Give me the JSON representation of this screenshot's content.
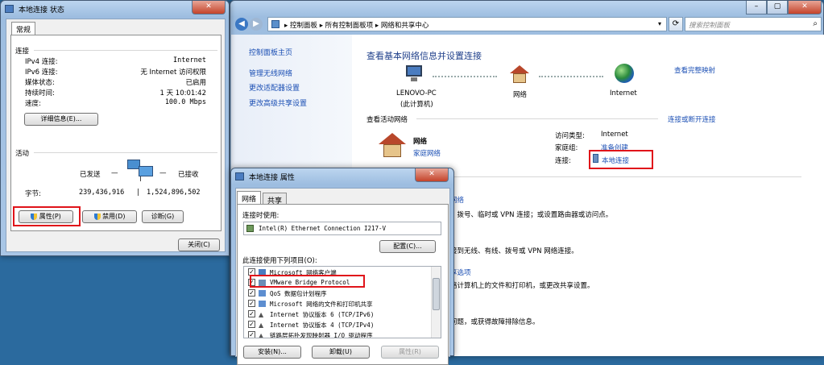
{
  "status_window": {
    "title": "本地连接 状态",
    "tab": "常规",
    "connection_header": "连接",
    "rows": [
      {
        "label": "IPv4 连接:",
        "value": "Internet"
      },
      {
        "label": "IPv6 连接:",
        "value": "无 Internet 访问权限"
      },
      {
        "label": "媒体状态:",
        "value": "已启用"
      },
      {
        "label": "持续时间:",
        "value": "1 天 10:01:42"
      },
      {
        "label": "速度:",
        "value": "100.0 Mbps"
      }
    ],
    "details_button": "详细信息(E)...",
    "activity_header": "活动",
    "sent_label": "已发送",
    "received_label": "已接收",
    "bytes_label": "字节:",
    "bytes_sent": "239,436,916",
    "bytes_received": "1,524,896,502",
    "properties_button": "属性(P)",
    "disable_button": "禁用(D)",
    "diagnose_button": "诊断(G)",
    "close_button": "关闭(C)"
  },
  "network_center": {
    "breadcrumb": [
      "控制面板",
      "所有控制面板项",
      "网络和共享中心"
    ],
    "search_placeholder": "搜索控制面板",
    "sidebar": [
      "控制面板主页",
      "管理无线网络",
      "更改适配器设置",
      "更改高级共享设置"
    ],
    "heading": "查看基本网络信息并设置连接",
    "full_map_link": "查看完整映射",
    "map": {
      "pc_name": "LENOVO-PC",
      "pc_sub": "(此计算机)",
      "network": "网络",
      "internet": "Internet"
    },
    "active_networks_label": "查看活动网络",
    "connect_disconnect_link": "连接或断开连接",
    "network_name": "网络",
    "network_type": "家庭网络",
    "access_type_label": "访问类型:",
    "access_type_value": "Internet",
    "homegroup_label": "家庭组:",
    "homegroup_value": "准备创建",
    "connection_label": "连接:",
    "connection_value": "本地连接",
    "partial_lines": [
      "网络",
      "、拨号、临时或 VPN 连接；或设置路由器或访问点。",
      "接到无线、有线、拨号或 VPN 网络连接。",
      "享选项",
      "络计算机上的文件和打印机，或更改共享设置。",
      "问题，或获得故障排除信息。"
    ]
  },
  "properties_window": {
    "title": "本地连接 属性",
    "tabs": [
      "网络",
      "共享"
    ],
    "connect_using_label": "连接时使用:",
    "adapter": "Intel(R) Ethernet Connection I217-V",
    "configure_button": "配置(C)...",
    "items_label": "此连接使用下列项目(O):",
    "items": [
      "Microsoft 网络客户端",
      "VMware Bridge Protocol",
      "QoS 数据包计划程序",
      "Microsoft 网络的文件和打印机共享",
      "Internet 协议版本 6 (TCP/IPv6)",
      "Internet 协议版本 4 (TCP/IPv4)",
      "链路层拓扑发现映射器 I/O 驱动程序"
    ],
    "install_button": "安装(N)...",
    "uninstall_button": "卸载(U)",
    "properties_button": "属性(R)"
  },
  "colors": {
    "highlight": "#e0141a",
    "link": "#1b4fb4",
    "desktop": "#2b6a9e"
  }
}
